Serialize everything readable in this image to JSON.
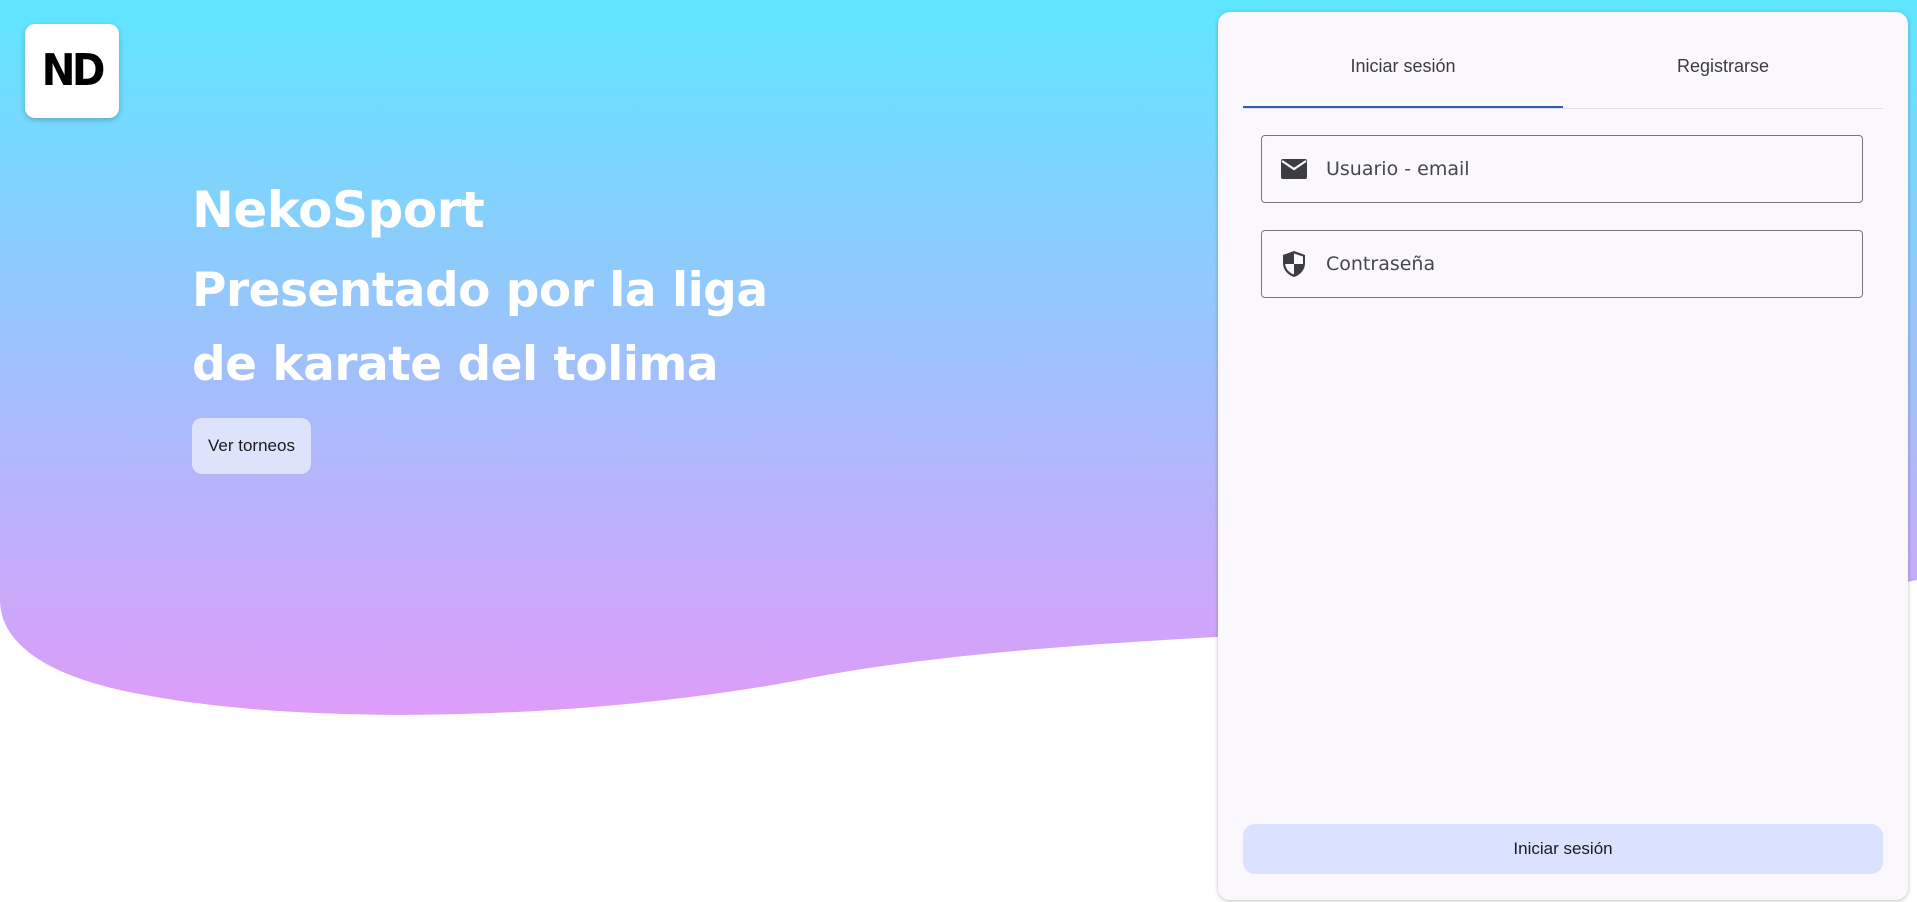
{
  "colors": {
    "gradient_top": "#5fe6ff",
    "gradient_bottom": "#df9cf8",
    "panel_background": "#fbf8fd",
    "tab_indicator": "#2f5fb5",
    "button_tonal": "#dae2ff"
  },
  "logo": {
    "text": "ND"
  },
  "hero": {
    "brand": "NekoSport",
    "headline": "Presentado por la liga de karate del tolima",
    "cta_label": "Ver torneos"
  },
  "auth": {
    "tabs": [
      {
        "label": "Iniciar sesión",
        "active": true
      },
      {
        "label": "Registrarse",
        "active": false
      }
    ],
    "fields": {
      "user": {
        "placeholder": "Usuario - email",
        "value": "",
        "icon": "email-icon"
      },
      "password": {
        "placeholder": "Contraseña",
        "value": "",
        "icon": "shield-icon"
      }
    },
    "submit_label": "Iniciar sesión"
  }
}
